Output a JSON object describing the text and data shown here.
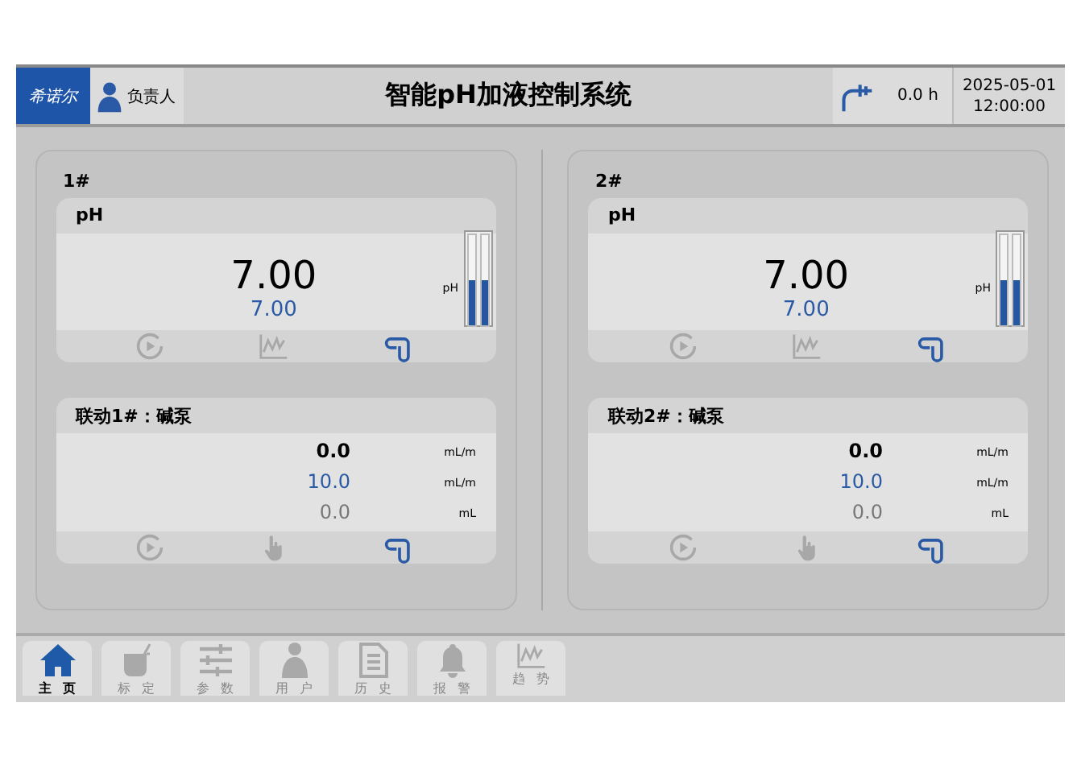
{
  "header": {
    "logo": "希诺尔",
    "user": "负责人",
    "title": "智能pH加液控制系统",
    "runtime": "0.0 h",
    "date": "2025-05-01",
    "time": "12:00:00"
  },
  "channels": [
    {
      "name": "1#",
      "sensor": {
        "title": "pH",
        "value": "7.00",
        "setpoint": "7.00",
        "unit": "pH",
        "level": 0.5,
        "actions": [
          {
            "kind": "play",
            "active": false
          },
          {
            "kind": "trend",
            "active": false
          },
          {
            "kind": "link",
            "active": true
          }
        ]
      },
      "pump": {
        "title": "联动1#：碱泵",
        "rows": [
          {
            "kind": "actual",
            "value": "0.0",
            "unit": "mL/m"
          },
          {
            "kind": "set",
            "value": "10.0",
            "unit": "mL/m"
          },
          {
            "kind": "total",
            "value": "0.0",
            "unit": "mL"
          }
        ],
        "actions": [
          {
            "kind": "play",
            "active": false
          },
          {
            "kind": "hand",
            "active": false
          },
          {
            "kind": "link",
            "active": true
          }
        ]
      }
    },
    {
      "name": "2#",
      "sensor": {
        "title": "pH",
        "value": "7.00",
        "setpoint": "7.00",
        "unit": "pH",
        "level": 0.5,
        "actions": [
          {
            "kind": "play",
            "active": false
          },
          {
            "kind": "trend",
            "active": false
          },
          {
            "kind": "link",
            "active": true
          }
        ]
      },
      "pump": {
        "title": "联动2#：碱泵",
        "rows": [
          {
            "kind": "actual",
            "value": "0.0",
            "unit": "mL/m"
          },
          {
            "kind": "set",
            "value": "10.0",
            "unit": "mL/m"
          },
          {
            "kind": "total",
            "value": "0.0",
            "unit": "mL"
          }
        ],
        "actions": [
          {
            "kind": "play",
            "active": false
          },
          {
            "kind": "hand",
            "active": false
          },
          {
            "kind": "link",
            "active": true
          }
        ]
      }
    }
  ],
  "nav": [
    {
      "kind": "home",
      "label": "主页",
      "selected": true
    },
    {
      "kind": "calibrate",
      "label": "标定",
      "selected": false
    },
    {
      "kind": "params",
      "label": "参数",
      "selected": false
    },
    {
      "kind": "user",
      "label": "用户",
      "selected": false
    },
    {
      "kind": "history",
      "label": "历史",
      "selected": false
    },
    {
      "kind": "alarm",
      "label": "报警",
      "selected": false
    },
    {
      "kind": "trend",
      "label": "趋势",
      "selected": false
    }
  ]
}
